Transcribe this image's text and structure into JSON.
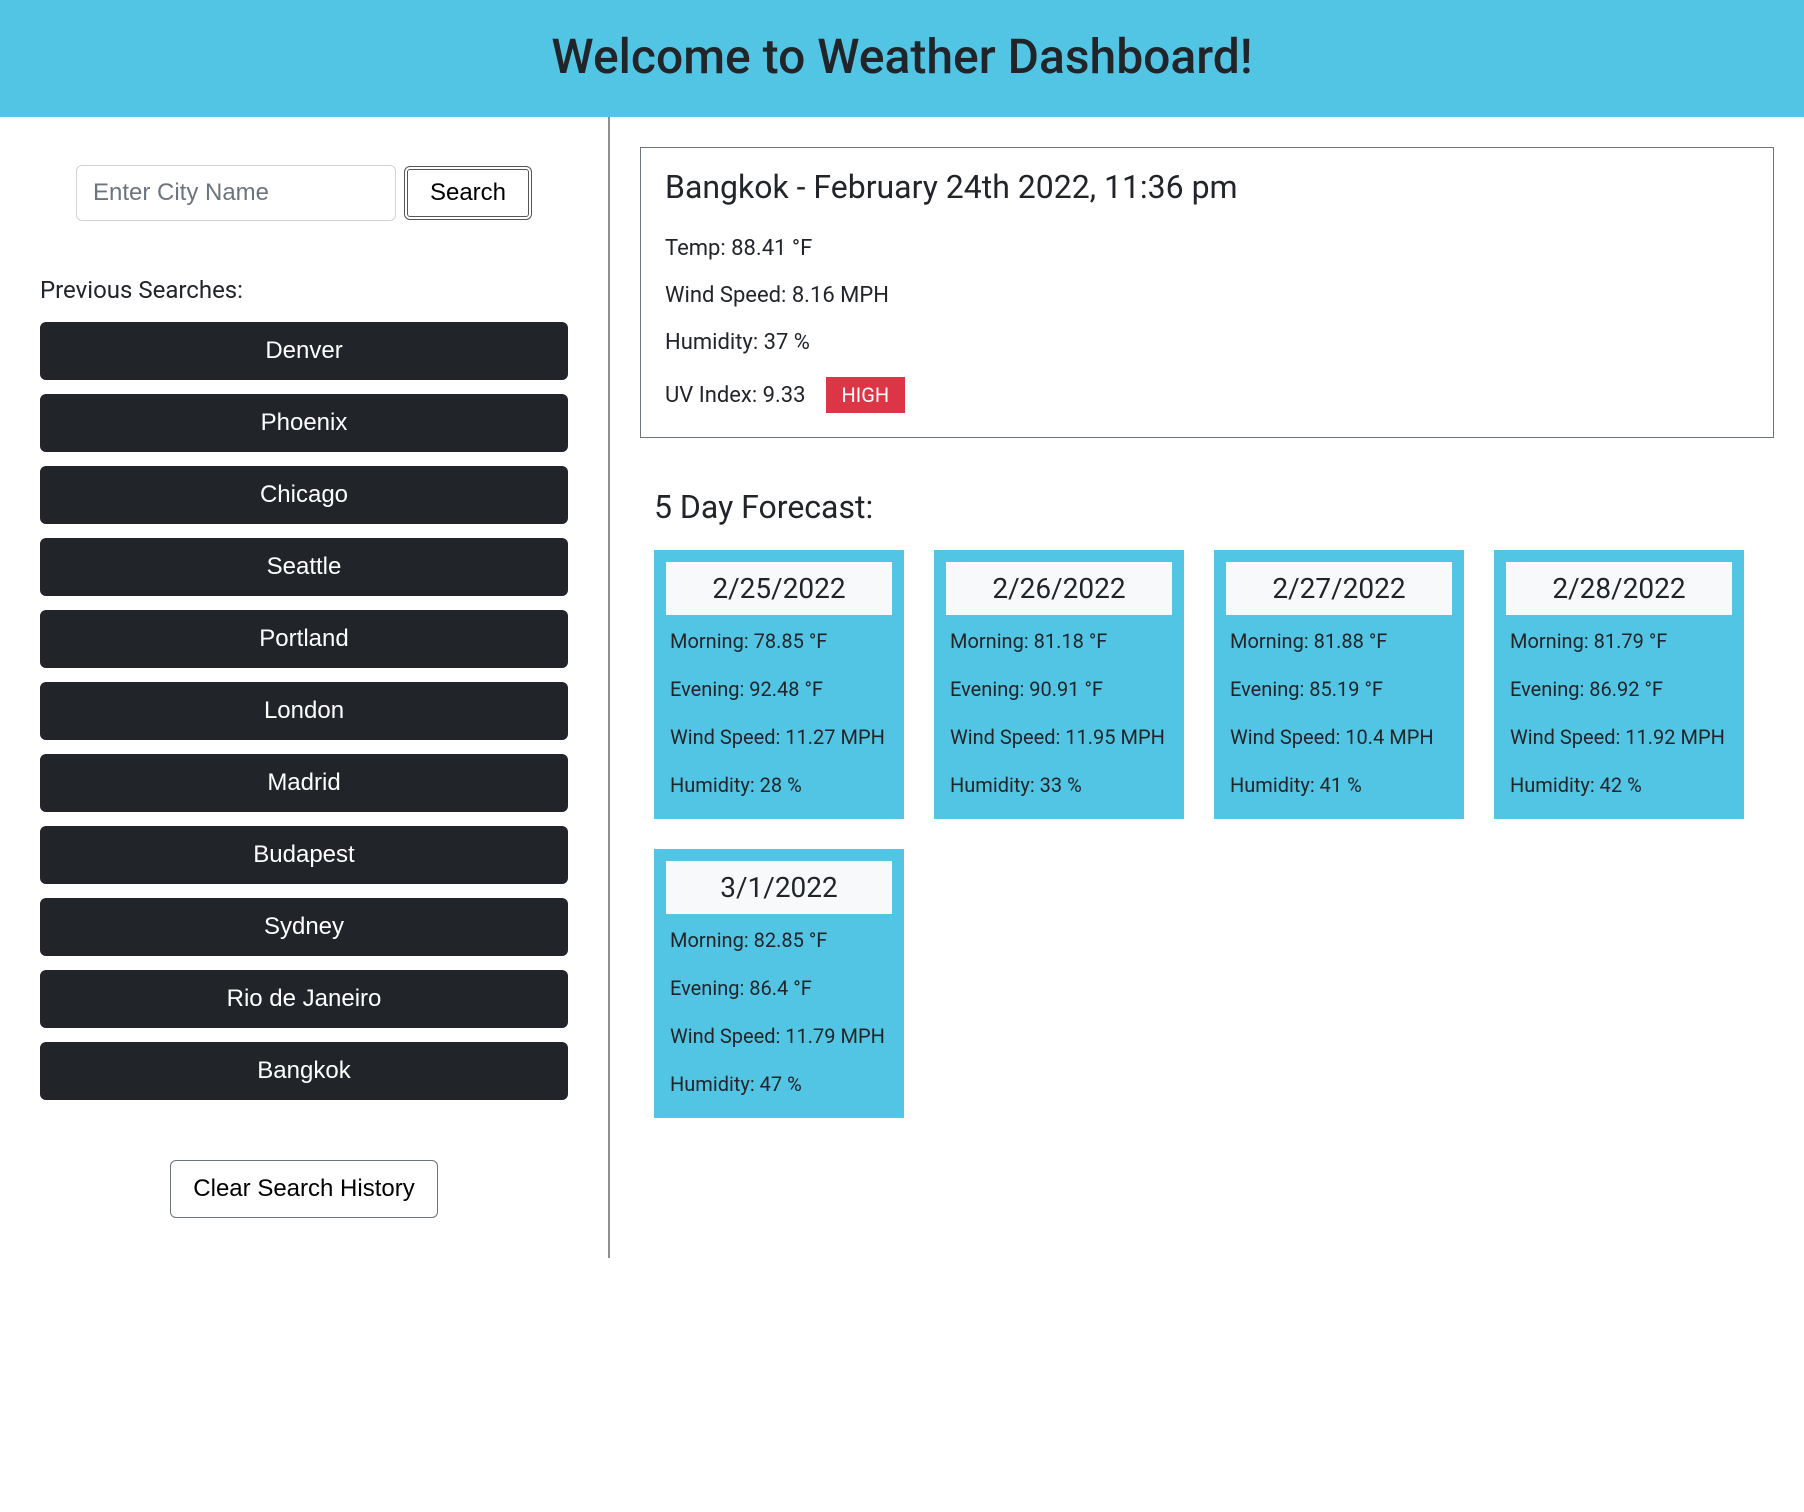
{
  "header": {
    "title": "Welcome to Weather Dashboard!"
  },
  "search": {
    "placeholder": "Enter City Name",
    "button": "Search"
  },
  "history": {
    "label": "Previous Searches:",
    "items": [
      "Denver",
      "Phoenix",
      "Chicago",
      "Seattle",
      "Portland",
      "London",
      "Madrid",
      "Budapest",
      "Sydney",
      "Rio de Janeiro",
      "Bangkok"
    ],
    "clear": "Clear Search History"
  },
  "current": {
    "title": "Bangkok - February 24th 2022, 11:36 pm",
    "temp": "Temp: 88.41 °F",
    "wind": "Wind Speed: 8.16 MPH",
    "humidity": "Humidity: 37 %",
    "uv_label": "UV Index: 9.33",
    "uv_badge": "HIGH"
  },
  "forecast": {
    "title": "5 Day Forecast:",
    "days": [
      {
        "date": "2/25/2022",
        "morning": "Morning: 78.85 °F",
        "evening": "Evening: 92.48 °F",
        "wind": "Wind Speed: 11.27 MPH",
        "humidity": "Humidity: 28 %"
      },
      {
        "date": "2/26/2022",
        "morning": "Morning: 81.18 °F",
        "evening": "Evening: 90.91 °F",
        "wind": "Wind Speed: 11.95 MPH",
        "humidity": "Humidity: 33 %"
      },
      {
        "date": "2/27/2022",
        "morning": "Morning: 81.88 °F",
        "evening": "Evening: 85.19 °F",
        "wind": "Wind Speed: 10.4 MPH",
        "humidity": "Humidity: 41 %"
      },
      {
        "date": "2/28/2022",
        "morning": "Morning: 81.79 °F",
        "evening": "Evening: 86.92 °F",
        "wind": "Wind Speed: 11.92 MPH",
        "humidity": "Humidity: 42 %"
      },
      {
        "date": "3/1/2022",
        "morning": "Morning: 82.85 °F",
        "evening": "Evening: 86.4 °F",
        "wind": "Wind Speed: 11.79 MPH",
        "humidity": "Humidity: 47 %"
      }
    ]
  }
}
